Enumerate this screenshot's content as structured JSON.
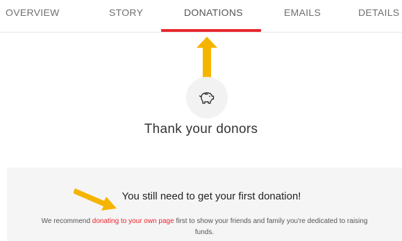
{
  "tabs": [
    {
      "label": "OVERVIEW"
    },
    {
      "label": "STORY"
    },
    {
      "label": "DONATIONS",
      "active": true
    },
    {
      "label": "EMAILS"
    },
    {
      "label": "DETAILS"
    }
  ],
  "colors": {
    "accent_red": "#e8262d",
    "annotation_yellow": "#f5b400",
    "notice_background": "#f5f5f5"
  },
  "icon": {
    "name": "piggy-bank-icon"
  },
  "main": {
    "title": "Thank your donors"
  },
  "notice": {
    "heading": "You still need to get your first donation!",
    "body_prefix": "We recommend ",
    "link_text": "donating to your own page",
    "body_suffix": " first to show your friends and family you're dedicated to raising funds."
  }
}
